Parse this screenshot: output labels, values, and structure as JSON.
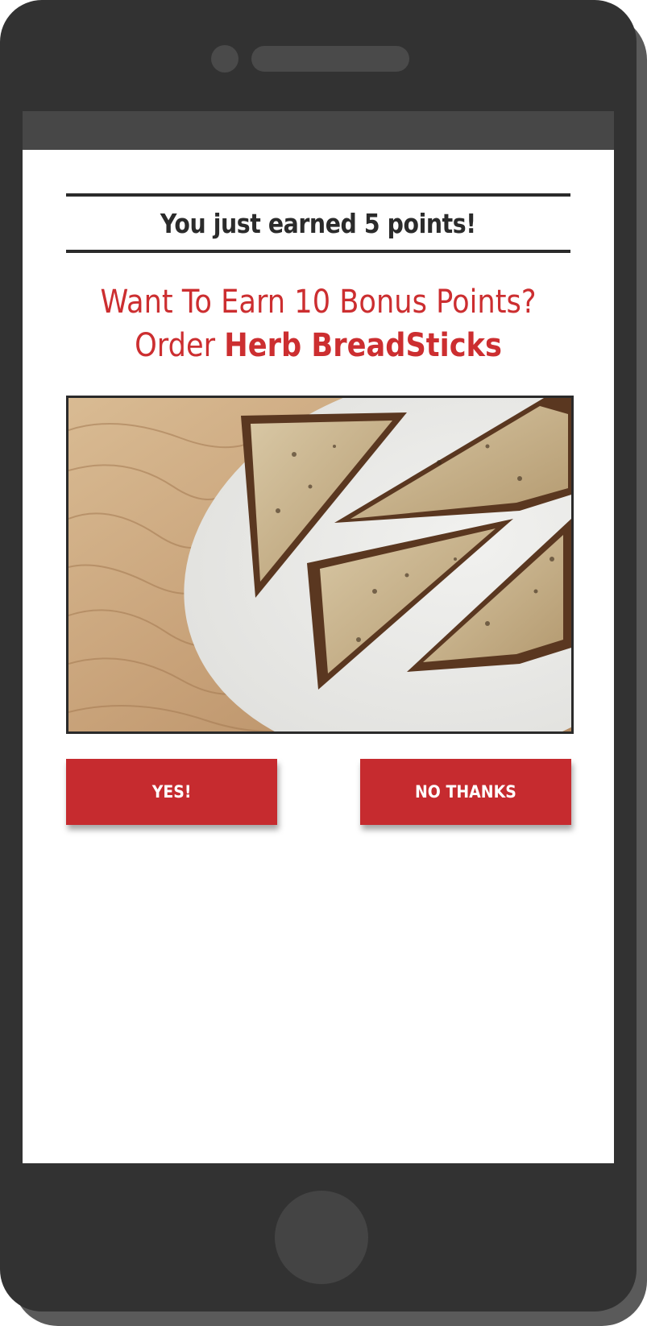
{
  "screen": {
    "points_banner": "You just earned 5 points!",
    "offer": {
      "line1": "Want To Earn 10 Bonus Points?",
      "line2_prefix": "Order ",
      "line2_item": "Herb BreadSticks"
    },
    "image": {
      "subject": "toasted bread triangles on a white plate on a wooden table"
    },
    "buttons": {
      "yes_label": "YES!",
      "no_label": "NO THANKS"
    }
  },
  "colors": {
    "accent_red": "#c62b2f",
    "headline_red": "#cc2e30",
    "phone_body": "#323232",
    "text_dark": "#2b2b2b"
  }
}
